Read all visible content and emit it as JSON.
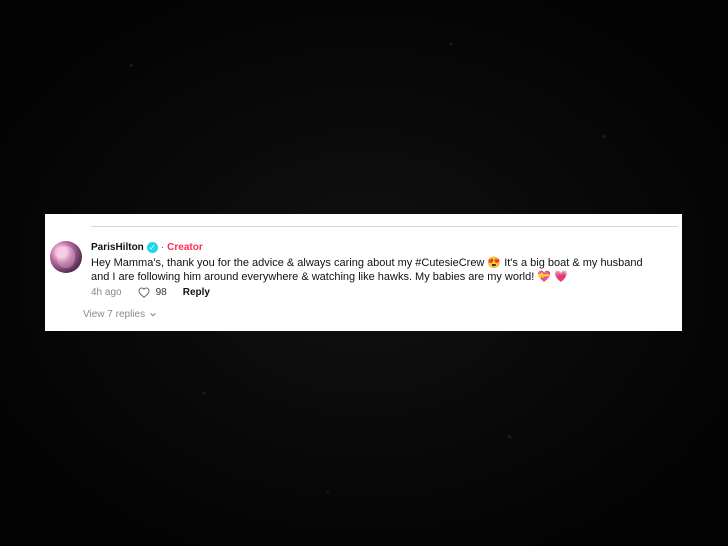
{
  "comment": {
    "username": "ParisHilton",
    "badge": "Creator",
    "text": "Hey Mamma's, thank you for the advice & always caring about my #CutesieCrew 😍 It's a big boat & my husband and I are following him around everywhere & watching like hawks. My babies are my world! 💝 💗",
    "time": "4h ago",
    "likes": "98",
    "reply_label": "Reply",
    "view_replies": "View 7 replies"
  },
  "colors": {
    "creator": "#fe2c55",
    "verified": "#20d5ec"
  },
  "icons": {
    "verified": "verified-badge-icon",
    "like": "heart-icon",
    "expand": "chevron-down-icon"
  }
}
